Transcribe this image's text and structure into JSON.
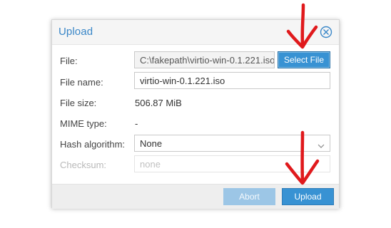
{
  "dialog": {
    "title": "Upload",
    "close_icon": "close-circle-icon"
  },
  "form": {
    "file_label": "File:",
    "file_value": "C:\\fakepath\\virtio-win-0.1.221.iso",
    "select_file_label": "Select File",
    "file_name_label": "File name:",
    "file_name_value": "virtio-win-0.1.221.iso",
    "file_size_label": "File size:",
    "file_size_value": "506.87 MiB",
    "mime_type_label": "MIME type:",
    "mime_type_value": "-",
    "hash_algorithm_label": "Hash algorithm:",
    "hash_algorithm_value": "None",
    "checksum_label": "Checksum:",
    "checksum_placeholder": "none"
  },
  "footer": {
    "abort_label": "Abort",
    "upload_label": "Upload"
  },
  "colors": {
    "accent": "#3892d3",
    "title": "#3a87c8",
    "annotation_arrow": "#e0191c"
  }
}
